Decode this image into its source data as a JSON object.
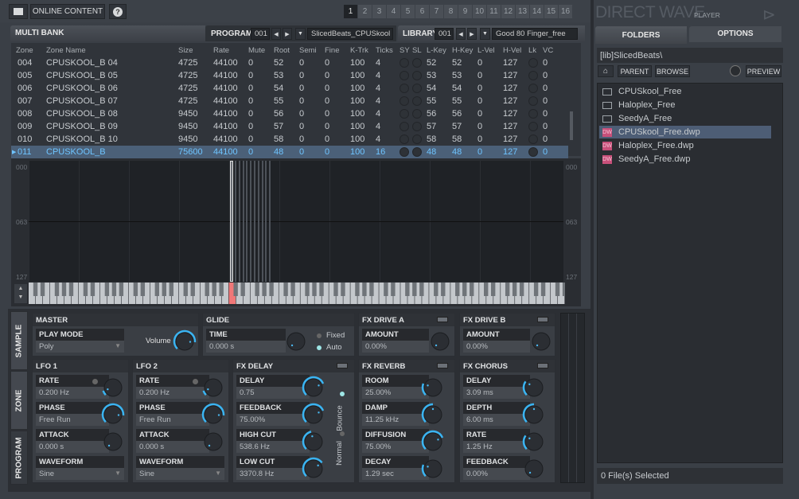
{
  "topbar": {
    "online_content": "ONLINE CONTENT",
    "help": "?",
    "pages": [
      "1",
      "2",
      "3",
      "4",
      "5",
      "6",
      "7",
      "8",
      "9",
      "10",
      "11",
      "12",
      "13",
      "14",
      "15",
      "16"
    ],
    "active_page": "1"
  },
  "header": {
    "multi_bank": "MULTI BANK",
    "program_label": "PROGRAM",
    "program_num": "001",
    "program_name": "SlicedBeats_CPUSkool",
    "library_label": "LIBRARY",
    "library_num": "001",
    "library_name": "Good 80 Finger_free"
  },
  "table": {
    "columns": [
      "Zone",
      "Zone Name",
      "Size",
      "Rate",
      "Mute",
      "Root",
      "Semi",
      "Fine",
      "K-Trk",
      "Ticks",
      "SY",
      "SL",
      "L-Key",
      "H-Key",
      "L-Vel",
      "H-Vel",
      "Lk",
      "VC"
    ],
    "rows": [
      [
        "004",
        "CPUSKOOL_B 04",
        "4725",
        "44100",
        "0",
        "52",
        "0",
        "0",
        "100",
        "4",
        "52",
        "52",
        "0",
        "127",
        "0"
      ],
      [
        "005",
        "CPUSKOOL_B 05",
        "4725",
        "44100",
        "0",
        "53",
        "0",
        "0",
        "100",
        "4",
        "53",
        "53",
        "0",
        "127",
        "0"
      ],
      [
        "006",
        "CPUSKOOL_B 06",
        "4725",
        "44100",
        "0",
        "54",
        "0",
        "0",
        "100",
        "4",
        "54",
        "54",
        "0",
        "127",
        "0"
      ],
      [
        "007",
        "CPUSKOOL_B 07",
        "4725",
        "44100",
        "0",
        "55",
        "0",
        "0",
        "100",
        "4",
        "55",
        "55",
        "0",
        "127",
        "0"
      ],
      [
        "008",
        "CPUSKOOL_B 08",
        "9450",
        "44100",
        "0",
        "56",
        "0",
        "0",
        "100",
        "4",
        "56",
        "56",
        "0",
        "127",
        "0"
      ],
      [
        "009",
        "CPUSKOOL_B 09",
        "9450",
        "44100",
        "0",
        "57",
        "0",
        "0",
        "100",
        "4",
        "57",
        "57",
        "0",
        "127",
        "0"
      ],
      [
        "010",
        "CPUSKOOL_B 10",
        "9450",
        "44100",
        "0",
        "58",
        "0",
        "0",
        "100",
        "4",
        "58",
        "58",
        "0",
        "127",
        "0"
      ],
      [
        "011",
        "CPUSKOOL_B",
        "75600",
        "44100",
        "0",
        "48",
        "0",
        "0",
        "100",
        "16",
        "48",
        "48",
        "0",
        "127",
        "0"
      ]
    ],
    "selected_row": 7
  },
  "zonemap": {
    "labels": [
      "000",
      "063",
      "127"
    ]
  },
  "sidetabs": [
    "SAMPLE",
    "ZONE",
    "PROGRAM"
  ],
  "master": {
    "title": "MASTER",
    "play_mode_label": "PLAY MODE",
    "play_mode": "Poly",
    "volume_label": "Volume",
    "volume": 0.85
  },
  "glide": {
    "title": "GLIDE",
    "time_label": "TIME",
    "time": "0.000 s",
    "time_knob": 0,
    "fixed": "Fixed",
    "auto": "Auto"
  },
  "drive_a": {
    "title": "FX DRIVE A",
    "amount_label": "AMOUNT",
    "amount": "0.00%",
    "knob": 0
  },
  "drive_b": {
    "title": "FX DRIVE B",
    "amount_label": "AMOUNT",
    "amount": "0.00%",
    "knob": 0
  },
  "lfo1": {
    "title": "LFO 1",
    "params": [
      {
        "label": "RATE",
        "value": "0.200 Hz",
        "knob": 0.1
      },
      {
        "label": "PHASE",
        "value": "Free Run",
        "knob": 0.85
      },
      {
        "label": "ATTACK",
        "value": "0.000 s",
        "knob": 0
      }
    ],
    "waveform_label": "WAVEFORM",
    "waveform": "Sine"
  },
  "lfo2": {
    "title": "LFO 2",
    "params": [
      {
        "label": "RATE",
        "value": "0.200 Hz",
        "knob": 0.1
      },
      {
        "label": "PHASE",
        "value": "Free Run",
        "knob": 0.85
      },
      {
        "label": "ATTACK",
        "value": "0.000 s",
        "knob": 0
      }
    ],
    "waveform_label": "WAVEFORM",
    "waveform": "Sine"
  },
  "fx_delay": {
    "title": "FX DELAY",
    "params": [
      {
        "label": "DELAY",
        "value": "0.75",
        "knob": 0.75
      },
      {
        "label": "FEEDBACK",
        "value": "75.00%",
        "knob": 0.75
      },
      {
        "label": "HIGH CUT",
        "value": "538.6 Hz",
        "knob": 0.45
      },
      {
        "label": "LOW CUT",
        "value": "3370.8 Hz",
        "knob": 0.7
      }
    ],
    "bounce": "Bounce",
    "normal": "Normal"
  },
  "fx_reverb": {
    "title": "FX REVERB",
    "params": [
      {
        "label": "ROOM",
        "value": "25.00%",
        "knob": 0.25
      },
      {
        "label": "DAMP",
        "value": "11.25 kHz",
        "knob": 0.5
      },
      {
        "label": "DIFFUSION",
        "value": "75.00%",
        "knob": 0.75
      },
      {
        "label": "DECAY",
        "value": "1.29 sec",
        "knob": 0.25
      }
    ]
  },
  "fx_chorus": {
    "title": "FX CHORUS",
    "params": [
      {
        "label": "DELAY",
        "value": "3.09 ms",
        "knob": 0.3
      },
      {
        "label": "DEPTH",
        "value": "6.00 ms",
        "knob": 0.5
      },
      {
        "label": "RATE",
        "value": "1.25 Hz",
        "knob": 0.3
      },
      {
        "label": "FEEDBACK",
        "value": "0.00%",
        "knob": 0
      }
    ]
  },
  "browser": {
    "title": "DIRECT WAVE",
    "subtitle": "PLAYER",
    "tab_folders": "FOLDERS",
    "tab_options": "OPTIONS",
    "path": "[lib]SlicedBeats\\",
    "parent": "PARENT",
    "browse": "BROWSE",
    "preview": "PREVIEW",
    "items": [
      {
        "name": "CPUSkool_Free",
        "type": "folder"
      },
      {
        "name": "Haloplex_Free",
        "type": "folder"
      },
      {
        "name": "SeedyA_Free",
        "type": "folder"
      },
      {
        "name": "CPUSkool_Free.dwp",
        "type": "dwp",
        "selected": true
      },
      {
        "name": "Haloplex_Free.dwp",
        "type": "dwp"
      },
      {
        "name": "SeedyA_Free.dwp",
        "type": "dwp"
      }
    ],
    "dw_badge": "DW",
    "status": "0 File(s) Selected"
  },
  "colors": {
    "accent": "#3ab4f2",
    "selected_row": "#4b6078",
    "dwp": "#c8507a"
  }
}
